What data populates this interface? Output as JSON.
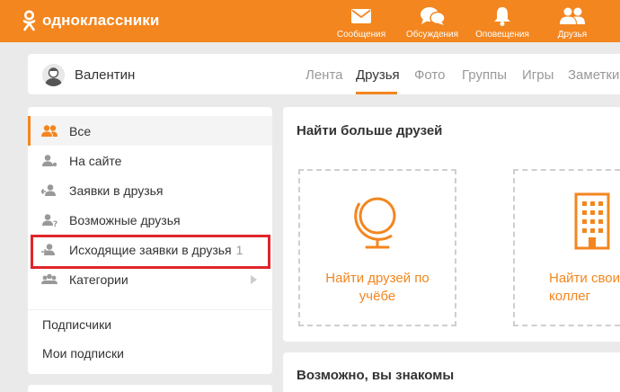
{
  "header": {
    "logo_text": "одноклассники",
    "nav": [
      {
        "label": "Сообщения",
        "icon": "envelope-icon"
      },
      {
        "label": "Обсуждения",
        "icon": "chat-bubbles-icon"
      },
      {
        "label": "Оповещения",
        "icon": "bell-icon"
      },
      {
        "label": "Друзья",
        "icon": "friends-icon"
      }
    ]
  },
  "profile": {
    "name": "Валентин",
    "tabs": [
      "Лента",
      "Друзья",
      "Фото",
      "Группы",
      "Игры",
      "Заметки"
    ],
    "active_tab": "Друзья"
  },
  "sidebar": {
    "items": [
      {
        "label": "Все",
        "icon": "group-icon",
        "active": true
      },
      {
        "label": "На сайте",
        "icon": "user-online-icon"
      },
      {
        "label": "Заявки в друзья",
        "icon": "incoming-request-icon"
      },
      {
        "label": "Возможные друзья",
        "icon": "user-question-icon"
      },
      {
        "label": "Исходящие заявки в друзья",
        "icon": "outgoing-request-icon",
        "count": "1"
      },
      {
        "label": "Категории",
        "icon": "categories-icon"
      }
    ],
    "links": [
      "Подписчики",
      "Мои подписки"
    ]
  },
  "main": {
    "find_title": "Найти больше друзей",
    "cards": [
      {
        "label": "Найти друзей по\nучёбе",
        "icon": "globe-icon"
      },
      {
        "label": "Найти своих\nколлег",
        "icon": "building-icon"
      }
    ],
    "maybe_title": "Возможно, вы знакомы"
  },
  "colors": {
    "accent": "#f3861f",
    "highlight": "#e0252b"
  }
}
